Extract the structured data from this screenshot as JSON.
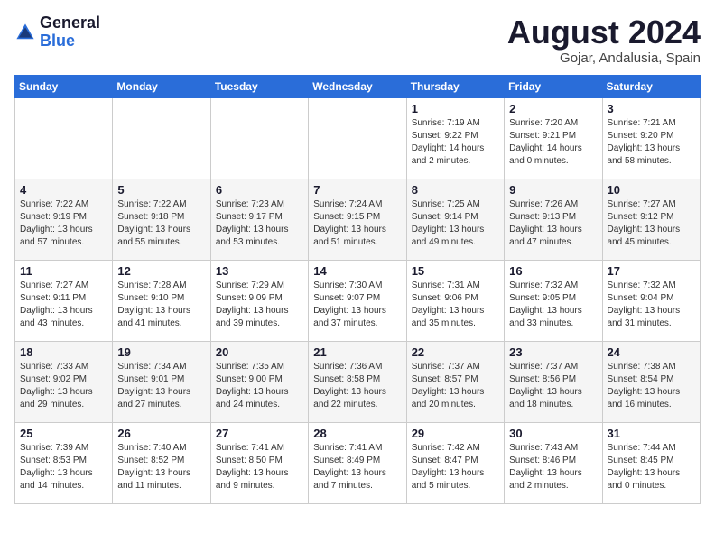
{
  "header": {
    "logo_general": "General",
    "logo_blue": "Blue",
    "month_title": "August 2024",
    "location": "Gojar, Andalusia, Spain"
  },
  "weekdays": [
    "Sunday",
    "Monday",
    "Tuesday",
    "Wednesday",
    "Thursday",
    "Friday",
    "Saturday"
  ],
  "weeks": [
    [
      {
        "day": "",
        "info": ""
      },
      {
        "day": "",
        "info": ""
      },
      {
        "day": "",
        "info": ""
      },
      {
        "day": "",
        "info": ""
      },
      {
        "day": "1",
        "info": "Sunrise: 7:19 AM\nSunset: 9:22 PM\nDaylight: 14 hours\nand 2 minutes."
      },
      {
        "day": "2",
        "info": "Sunrise: 7:20 AM\nSunset: 9:21 PM\nDaylight: 14 hours\nand 0 minutes."
      },
      {
        "day": "3",
        "info": "Sunrise: 7:21 AM\nSunset: 9:20 PM\nDaylight: 13 hours\nand 58 minutes."
      }
    ],
    [
      {
        "day": "4",
        "info": "Sunrise: 7:22 AM\nSunset: 9:19 PM\nDaylight: 13 hours\nand 57 minutes."
      },
      {
        "day": "5",
        "info": "Sunrise: 7:22 AM\nSunset: 9:18 PM\nDaylight: 13 hours\nand 55 minutes."
      },
      {
        "day": "6",
        "info": "Sunrise: 7:23 AM\nSunset: 9:17 PM\nDaylight: 13 hours\nand 53 minutes."
      },
      {
        "day": "7",
        "info": "Sunrise: 7:24 AM\nSunset: 9:15 PM\nDaylight: 13 hours\nand 51 minutes."
      },
      {
        "day": "8",
        "info": "Sunrise: 7:25 AM\nSunset: 9:14 PM\nDaylight: 13 hours\nand 49 minutes."
      },
      {
        "day": "9",
        "info": "Sunrise: 7:26 AM\nSunset: 9:13 PM\nDaylight: 13 hours\nand 47 minutes."
      },
      {
        "day": "10",
        "info": "Sunrise: 7:27 AM\nSunset: 9:12 PM\nDaylight: 13 hours\nand 45 minutes."
      }
    ],
    [
      {
        "day": "11",
        "info": "Sunrise: 7:27 AM\nSunset: 9:11 PM\nDaylight: 13 hours\nand 43 minutes."
      },
      {
        "day": "12",
        "info": "Sunrise: 7:28 AM\nSunset: 9:10 PM\nDaylight: 13 hours\nand 41 minutes."
      },
      {
        "day": "13",
        "info": "Sunrise: 7:29 AM\nSunset: 9:09 PM\nDaylight: 13 hours\nand 39 minutes."
      },
      {
        "day": "14",
        "info": "Sunrise: 7:30 AM\nSunset: 9:07 PM\nDaylight: 13 hours\nand 37 minutes."
      },
      {
        "day": "15",
        "info": "Sunrise: 7:31 AM\nSunset: 9:06 PM\nDaylight: 13 hours\nand 35 minutes."
      },
      {
        "day": "16",
        "info": "Sunrise: 7:32 AM\nSunset: 9:05 PM\nDaylight: 13 hours\nand 33 minutes."
      },
      {
        "day": "17",
        "info": "Sunrise: 7:32 AM\nSunset: 9:04 PM\nDaylight: 13 hours\nand 31 minutes."
      }
    ],
    [
      {
        "day": "18",
        "info": "Sunrise: 7:33 AM\nSunset: 9:02 PM\nDaylight: 13 hours\nand 29 minutes."
      },
      {
        "day": "19",
        "info": "Sunrise: 7:34 AM\nSunset: 9:01 PM\nDaylight: 13 hours\nand 27 minutes."
      },
      {
        "day": "20",
        "info": "Sunrise: 7:35 AM\nSunset: 9:00 PM\nDaylight: 13 hours\nand 24 minutes."
      },
      {
        "day": "21",
        "info": "Sunrise: 7:36 AM\nSunset: 8:58 PM\nDaylight: 13 hours\nand 22 minutes."
      },
      {
        "day": "22",
        "info": "Sunrise: 7:37 AM\nSunset: 8:57 PM\nDaylight: 13 hours\nand 20 minutes."
      },
      {
        "day": "23",
        "info": "Sunrise: 7:37 AM\nSunset: 8:56 PM\nDaylight: 13 hours\nand 18 minutes."
      },
      {
        "day": "24",
        "info": "Sunrise: 7:38 AM\nSunset: 8:54 PM\nDaylight: 13 hours\nand 16 minutes."
      }
    ],
    [
      {
        "day": "25",
        "info": "Sunrise: 7:39 AM\nSunset: 8:53 PM\nDaylight: 13 hours\nand 14 minutes."
      },
      {
        "day": "26",
        "info": "Sunrise: 7:40 AM\nSunset: 8:52 PM\nDaylight: 13 hours\nand 11 minutes."
      },
      {
        "day": "27",
        "info": "Sunrise: 7:41 AM\nSunset: 8:50 PM\nDaylight: 13 hours\nand 9 minutes."
      },
      {
        "day": "28",
        "info": "Sunrise: 7:41 AM\nSunset: 8:49 PM\nDaylight: 13 hours\nand 7 minutes."
      },
      {
        "day": "29",
        "info": "Sunrise: 7:42 AM\nSunset: 8:47 PM\nDaylight: 13 hours\nand 5 minutes."
      },
      {
        "day": "30",
        "info": "Sunrise: 7:43 AM\nSunset: 8:46 PM\nDaylight: 13 hours\nand 2 minutes."
      },
      {
        "day": "31",
        "info": "Sunrise: 7:44 AM\nSunset: 8:45 PM\nDaylight: 13 hours\nand 0 minutes."
      }
    ]
  ]
}
